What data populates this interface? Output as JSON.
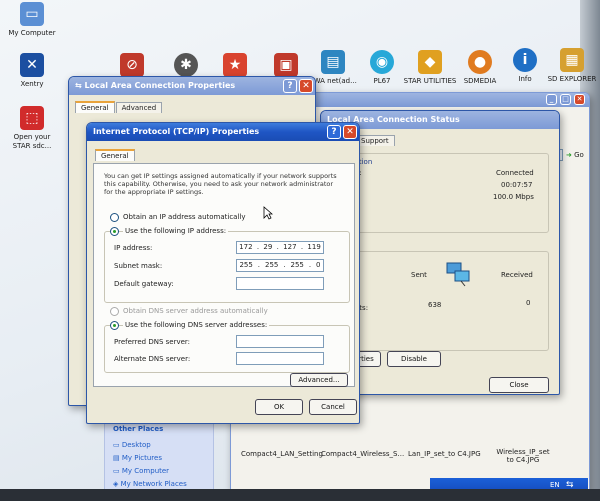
{
  "desktop": {
    "icons": [
      {
        "label": "My Computer",
        "icon": "computer-icon",
        "color": "#5b8fd4",
        "glyph": "▭"
      },
      {
        "label": "Xentry",
        "icon": "xentry-icon",
        "color": "#1c4fa1",
        "glyph": "✕"
      },
      {
        "label": "",
        "icon": "no-entry-icon",
        "color": "#c0392b",
        "glyph": "⊘"
      },
      {
        "label": "",
        "icon": "mercedes-star-icon",
        "color": "#555555",
        "glyph": "✱"
      },
      {
        "label": "",
        "icon": "star-app-icon",
        "color": "#d9432f",
        "glyph": "★"
      },
      {
        "label": "",
        "icon": "red-toolbox-icon",
        "color": "#c0392b",
        "glyph": "▣"
      },
      {
        "label": "EWA net(ad...",
        "icon": "ewa-icon",
        "color": "#2e86c1",
        "glyph": "▤"
      },
      {
        "label": "PL67",
        "icon": "pl67-icon",
        "color": "#27a8d8",
        "glyph": "◉"
      },
      {
        "label": "STAR UTILITIES",
        "icon": "star-utilities-icon",
        "color": "#e0a020",
        "glyph": "◆"
      },
      {
        "label": "SDMEDIA",
        "icon": "sdmedia-icon",
        "color": "#e07b20",
        "glyph": "●"
      },
      {
        "label": "Info",
        "icon": "info-icon",
        "color": "#1f6fc5",
        "glyph": "i"
      },
      {
        "label": "SD EXPLORER",
        "icon": "sd-explorer-icon",
        "color": "#d6a030",
        "glyph": "▦"
      },
      {
        "label": "Open your STAR sdc...",
        "icon": "pdf-icon",
        "color": "#d12b2b",
        "glyph": "⬚"
      }
    ]
  },
  "lac_props": {
    "title": "Local Area Connection Properties",
    "tabs": [
      "General",
      "Advanced"
    ],
    "help": "?",
    "close": "✕"
  },
  "lac_status": {
    "title": "Local Area Connection Status",
    "tab": "Support",
    "status_label": "ction",
    "status_value": "Connected",
    "duration_label": "n:",
    "duration_value": "00:07:57",
    "speed_value": "100.0 Mbps",
    "sent_label": "Sent",
    "received_label": "Received",
    "packets_label": "ets:",
    "sent_packets": "638",
    "received_packets": "0",
    "properties_button": "rties",
    "disable_button": "Disable",
    "close_button": "Close"
  },
  "tcpip": {
    "title": "Internet Protocol (TCP/IP) Properties",
    "tab": "General",
    "description": "You can get IP settings assigned automatically if your network supports this capability. Otherwise, you need to ask your network administrator for the appropriate IP settings.",
    "obtain_auto": "Obtain an IP address automatically",
    "use_following": "Use the following IP address:",
    "ip_label": "IP address:",
    "ip_octets": [
      "172",
      "29",
      "127",
      "119"
    ],
    "subnet_label": "Subnet mask:",
    "subnet_octets": [
      "255",
      "255",
      "255",
      "0"
    ],
    "gateway_label": "Default gateway:",
    "dns_auto": "Obtain DNS server address automatically",
    "dns_following": "Use the following DNS server addresses:",
    "preferred_dns": "Preferred DNS server:",
    "alternate_dns": "Alternate DNS server:",
    "advanced_button": "Advanced...",
    "ok_button": "OK",
    "cancel_button": "Cancel"
  },
  "explorer": {
    "go": "Go",
    "other_places_header": "Other Places",
    "places": [
      "Desktop",
      "My Pictures",
      "My Computer",
      "My Network Places"
    ],
    "files": [
      "Compact4_LAN_Setting",
      "Compact4_Wireless_S...",
      "Lan_IP_set_to C4.JPG",
      "Wireless_IP_set to C4.JPG"
    ]
  },
  "tray": {
    "lang": "EN"
  }
}
